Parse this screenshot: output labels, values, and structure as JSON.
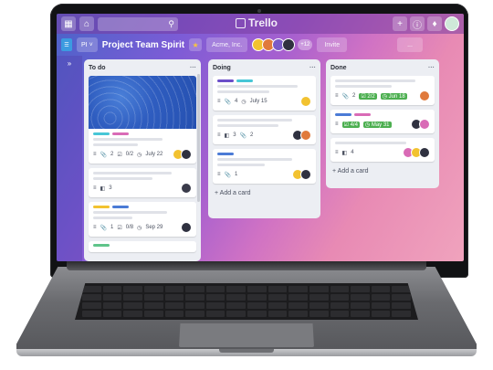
{
  "topbar": {
    "brand": "Trello",
    "icons": [
      "apps-grid-icon",
      "home-icon",
      "search-icon",
      "plus-icon",
      "info-icon",
      "bell-icon"
    ]
  },
  "board": {
    "workspace": "PI",
    "title": "Project Team Spirit",
    "org_label": "Acme, Inc.",
    "member_count": "+12",
    "invite_label": "Invite",
    "more_label": "..."
  },
  "lists": [
    {
      "title": "To do",
      "cards": [
        {
          "labels": [
            "#47c6d6",
            "#d96bb6"
          ],
          "attach": "2",
          "checklist": "0/2",
          "due": "July 22"
        },
        {
          "comments": "3"
        },
        {
          "labels": [
            "#f2c230",
            "#4b7bd6"
          ],
          "attach": "1",
          "checklist": "0/8",
          "due": "Sep 29"
        }
      ]
    },
    {
      "title": "Doing",
      "cards": [
        {
          "labels": [
            "#6b4fc9",
            "#47c6d6"
          ],
          "attach": "4",
          "due": "July 15"
        },
        {
          "comments": "3",
          "attach": "2"
        },
        {
          "labels": [
            "#4b7bd6"
          ],
          "attach": "1"
        }
      ],
      "add_card": "+ Add a card"
    },
    {
      "title": "Done",
      "cards": [
        {
          "attach": "2",
          "checklist": "2/2",
          "due": "Jun 18"
        },
        {
          "labels": [
            "#4b7bd6",
            "#d96bb6"
          ],
          "checklist": "4/4",
          "due": "May 31"
        },
        {
          "comments": "4"
        }
      ],
      "add_card": "+ Add a card"
    }
  ],
  "colors": {
    "accent_label_blue": "#4b7bd6",
    "label_pink": "#d96bb6",
    "label_cyan": "#47c6d6",
    "label_yellow": "#f2c230",
    "badge_green": "#4caf50"
  }
}
